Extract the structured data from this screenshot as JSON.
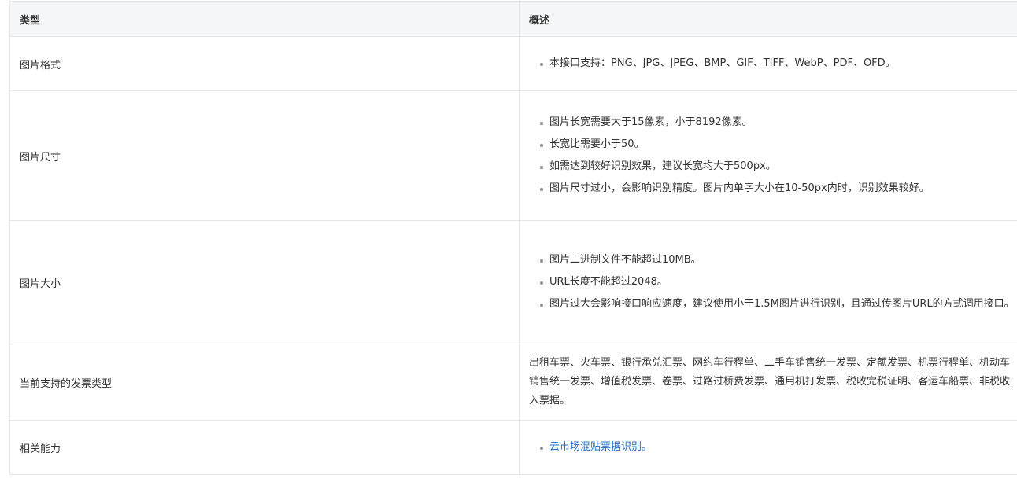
{
  "header": {
    "type_label": "类型",
    "desc_label": "概述"
  },
  "rows": [
    {
      "type": "图片格式",
      "items": [
        "本接口支持：PNG、JPG、JPEG、BMP、GIF、TIFF、WebP、PDF、OFD。"
      ]
    },
    {
      "type": "图片尺寸",
      "items": [
        "图片长宽需要大于15像素，小于8192像素。",
        "长宽比需要小于50。",
        "如需达到较好识别效果，建议长宽均大于500px。",
        "图片尺寸过小，会影响识别精度。图片内单字大小在10-50px内时，识别效果较好。"
      ]
    },
    {
      "type": "图片大小",
      "items": [
        "图片二进制文件不能超过10MB。",
        "URL长度不能超过2048。",
        "图片过大会影响接口响应速度，建议使用小于1.5M图片进行识别，且通过传图片URL的方式调用接口。"
      ]
    },
    {
      "type": "当前支持的发票类型",
      "text": "出租车票、火车票、银行承兑汇票、网约车行程单、二手车销售统一发票、定额发票、机票行程单、机动车销售统一发票、增值税发票、卷票、过路过桥费发票、通用机打发票、税收完税证明、客运车船票、非税收入票据。"
    },
    {
      "type": "相关能力",
      "link": "云市场混贴票据识别。"
    }
  ],
  "colors": {
    "header_bg": "#f5f6f7",
    "border": "#e4e6eb",
    "link": "#1f6fd1"
  }
}
